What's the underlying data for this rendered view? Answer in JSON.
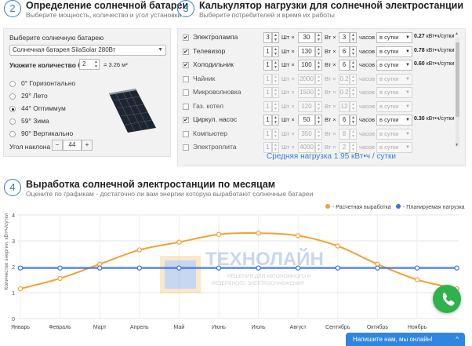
{
  "section2": {
    "number": "2",
    "title": "Определение солнечной батареи",
    "subtitle": "Выберите мощность, количество и угол установки",
    "battery_label": "Выберите солнечную батарею",
    "battery_value": "Солнечная батарея SilaSolar 280Вт",
    "qty_label": "Укажите количество СБ",
    "qty_value": "2",
    "area_text": "= 3.26 м²",
    "angles": [
      {
        "label": "0° Горизонтально",
        "selected": false
      },
      {
        "label": "29° Лето",
        "selected": false
      },
      {
        "label": "44° Оптиммум",
        "selected": true
      },
      {
        "label": "59° Зима",
        "selected": false
      },
      {
        "label": "90° Вертикально",
        "selected": false
      }
    ],
    "tilt_label": "Угол наклона",
    "tilt_minus": "−",
    "tilt_value": "44",
    "tilt_plus": "+"
  },
  "section3": {
    "number": "3",
    "title": "Калькулятор нагрузки для солнечной электростанции",
    "subtitle": "Выберите потребителей и время их работы",
    "rows": [
      {
        "name": "Электролампа",
        "checked": true,
        "qty": "3",
        "qty_unit": "Шт ×",
        "watts": "30",
        "watts_unit": "Вт ×",
        "hours": "3",
        "hours_unit": "часов",
        "period": "в сутки",
        "kwh": "0.27",
        "kwh_unit": "кВт•ч/сутки"
      },
      {
        "name": "Телевизор",
        "checked": true,
        "qty": "1",
        "qty_unit": "Шт ×",
        "watts": "130",
        "watts_unit": "Вт ×",
        "hours": "6",
        "hours_unit": "часов",
        "period": "в сутки",
        "kwh": "0.78",
        "kwh_unit": "кВт•ч/сутки"
      },
      {
        "name": "Холодильник",
        "checked": true,
        "qty": "1",
        "qty_unit": "Шт ×",
        "watts": "100",
        "watts_unit": "Вт ×",
        "hours": "6",
        "hours_unit": "часов",
        "period": "в сутки",
        "kwh": "0.60",
        "kwh_unit": "кВт•ч/сутки"
      },
      {
        "name": "Чайник",
        "checked": false,
        "qty": "1",
        "qty_unit": "Шт ×",
        "watts": "2000",
        "watts_unit": "Вт ×",
        "hours": "0.2",
        "hours_unit": "часов",
        "period": "в сутки",
        "kwh": "",
        "kwh_unit": ""
      },
      {
        "name": "Микроволновка",
        "checked": false,
        "qty": "1",
        "qty_unit": "Шт ×",
        "watts": "1500",
        "watts_unit": "Вт ×",
        "hours": "0.2",
        "hours_unit": "часов",
        "period": "в сутки",
        "kwh": "",
        "kwh_unit": ""
      },
      {
        "name": "Газ. котел",
        "checked": false,
        "qty": "1",
        "qty_unit": "Шт ×",
        "watts": "120",
        "watts_unit": "Вт ×",
        "hours": "12",
        "hours_unit": "часов",
        "period": "в сутки",
        "kwh": "",
        "kwh_unit": ""
      },
      {
        "name": "Циркул. насос",
        "checked": true,
        "qty": "1",
        "qty_unit": "Шт ×",
        "watts": "50",
        "watts_unit": "Вт ×",
        "hours": "6",
        "hours_unit": "часов",
        "period": "в сутки",
        "kwh": "0.30",
        "kwh_unit": "кВт•ч/сутки"
      },
      {
        "name": "Компьютер",
        "checked": false,
        "qty": "1",
        "qty_unit": "Шт ×",
        "watts": "350",
        "watts_unit": "Вт ×",
        "hours": "8",
        "hours_unit": "часов",
        "period": "в сутки",
        "kwh": "",
        "kwh_unit": ""
      },
      {
        "name": "Электроплита",
        "checked": false,
        "qty": "1",
        "qty_unit": "Шт ×",
        "watts": "4000",
        "watts_unit": "Вт ×",
        "hours": "2",
        "hours_unit": "часов",
        "period": "в сутки",
        "kwh": "",
        "kwh_unit": ""
      }
    ],
    "average_load": "Средняя нагрузка 1.95 кВт•ч / сутки"
  },
  "section4": {
    "number": "4",
    "title": "Выработка солнечной электростанции по месяцам",
    "subtitle": "Оцените по графикам - достаточно ли вам энергии которую выработают солнечные батареи"
  },
  "watermark": {
    "brand": "ТЕХНОЛАЙН",
    "tagline1": "РЕШЕНИЯ ДЛЯ АВТОНОМНОГО И",
    "tagline2": "РЕЗЕРВНОГО ЭЛЕКТРОСНАБЖЕНИЯ"
  },
  "chat": {
    "label": "Напишите нам, мы онлайн!",
    "phone_icon": "phone-icon"
  },
  "colors": {
    "accent": "#2f7fd1",
    "generation": "#f5a033",
    "load": "#3b73d6"
  },
  "chart_data": {
    "type": "line",
    "categories": [
      "Январь",
      "Февраль",
      "Март",
      "Апрель",
      "Май",
      "Июнь",
      "Июль",
      "Август",
      "Сентябрь",
      "Октябрь",
      "Ноябрь"
    ],
    "series": [
      {
        "name": "Расчетная выработка",
        "values": [
          1.15,
          1.55,
          2.1,
          2.65,
          2.95,
          3.25,
          3.3,
          3.2,
          2.8,
          2.1,
          1.5,
          1.15
        ]
      },
      {
        "name": "Планируемая нагрузка",
        "values": [
          1.95,
          1.95,
          1.95,
          1.95,
          1.95,
          1.95,
          1.95,
          1.95,
          1.95,
          1.95,
          1.95,
          1.95
        ]
      }
    ],
    "ylabel": "Количество энергии, кВт•ч/сутки",
    "ylim": [
      0,
      4
    ],
    "yticks": [
      "0",
      "1",
      "2",
      "3",
      "4"
    ],
    "grid": true,
    "legend_position": "top-right"
  }
}
